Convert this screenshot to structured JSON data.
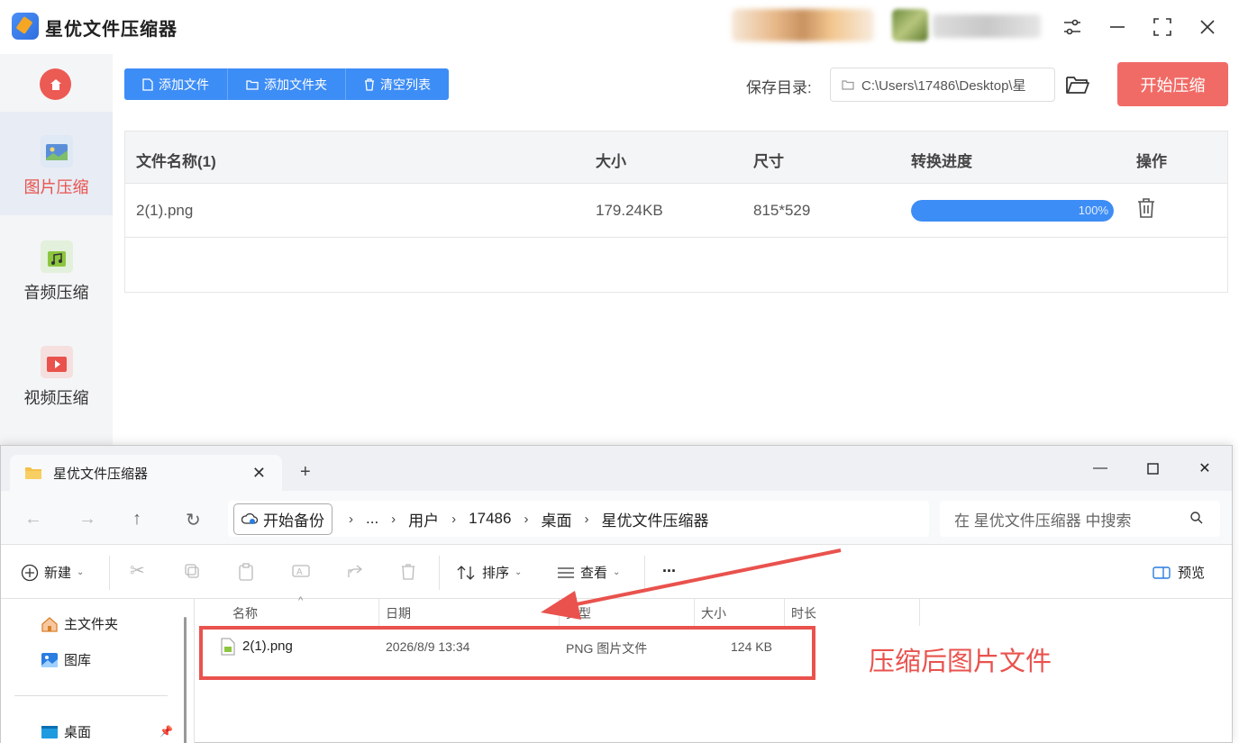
{
  "app": {
    "title": "星优文件压缩器",
    "sidebar": [
      {
        "label": "图片压缩",
        "icon": "image-icon",
        "active": true
      },
      {
        "label": "音频压缩",
        "icon": "music-icon",
        "active": false
      },
      {
        "label": "视频压缩",
        "icon": "video-icon",
        "active": false
      }
    ],
    "toolbar": {
      "add_file": "添加文件",
      "add_folder": "添加文件夹",
      "clear_list": "清空列表"
    },
    "save_label": "保存目录:",
    "save_path": "C:\\Users\\17486\\Desktop\\星",
    "start_button": "开始压缩",
    "table": {
      "headers": [
        "文件名称(1)",
        "大小",
        "尺寸",
        "转换进度",
        "操作"
      ],
      "rows": [
        {
          "name": "2(1).png",
          "size": "179.24KB",
          "dimensions": "815*529",
          "progress": 100,
          "progress_text": "100%"
        }
      ]
    },
    "colors": {
      "accent": "#3d8df6",
      "brand_red": "#f16b66",
      "active_text": "#e9524d"
    }
  },
  "explorer": {
    "tab_title": "星优文件压缩器",
    "breadcrumbs": [
      "开始备份",
      "...",
      "用户",
      "17486",
      "桌面",
      "星优文件压缩器"
    ],
    "search_placeholder": "在 星优文件压缩器 中搜索",
    "commands": {
      "new": "新建",
      "sort": "排序",
      "view": "查看",
      "more": "...",
      "preview": "预览"
    },
    "nav": [
      {
        "label": "主文件夹",
        "icon": "home-icon"
      },
      {
        "label": "图库",
        "icon": "gallery-icon"
      },
      {
        "label": "桌面",
        "icon": "desktop-icon"
      }
    ],
    "columns": [
      "名称",
      "日期",
      "类型",
      "大小",
      "时长"
    ],
    "files": [
      {
        "name": "2(1).png",
        "date": "2026/8/9 13:34",
        "type": "PNG 图片文件",
        "size": "124 KB"
      }
    ]
  },
  "annotation": "压缩后图片文件"
}
